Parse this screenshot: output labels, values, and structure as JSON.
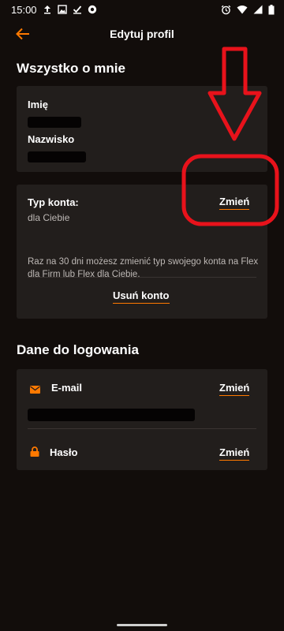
{
  "status_bar": {
    "time": "15:00"
  },
  "header": {
    "title": "Edytuj profil"
  },
  "about": {
    "section_title": "Wszystko o mnie",
    "first_name_label": "Imię",
    "last_name_label": "Nazwisko"
  },
  "account": {
    "type_label": "Typ konta:",
    "type_value": "dla Ciebie",
    "change_label": "Zmień",
    "note": "Raz na 30 dni możesz zmienić typ swojego konta na Flex dla Firm lub Flex dla Ciebie.",
    "delete_label": "Usuń konto"
  },
  "login": {
    "section_title": "Dane do logowania",
    "email_label": "E-mail",
    "email_change_label": "Zmień",
    "password_label": "Hasło",
    "password_change_label": "Zmień"
  },
  "colors": {
    "accent": "#ff7900",
    "annotation": "#e8121b",
    "background": "#120d0b",
    "card": "#221e1c"
  }
}
